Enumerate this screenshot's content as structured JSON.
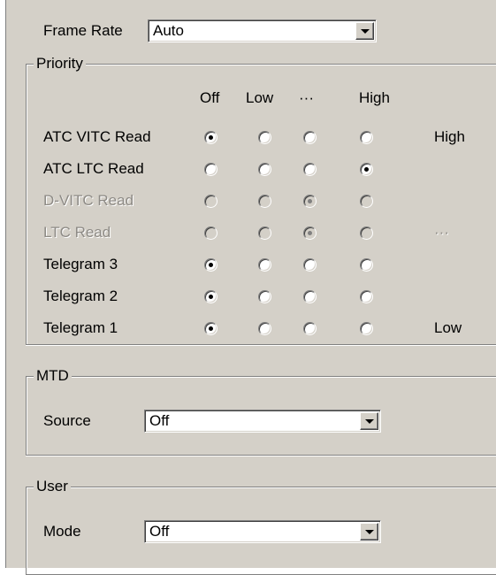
{
  "frame_rate": {
    "label": "Frame Rate",
    "value": "Auto"
  },
  "priority": {
    "title": "Priority",
    "columns": [
      "Off",
      "Low",
      "···",
      "High"
    ],
    "rows": [
      {
        "label": "ATC VITC Read",
        "selected": 0,
        "disabled": false,
        "side": "High"
      },
      {
        "label": "ATC LTC Read",
        "selected": 3,
        "disabled": false,
        "side": ""
      },
      {
        "label": "D-VITC Read",
        "selected": 2,
        "disabled": true,
        "side": ""
      },
      {
        "label": "LTC Read",
        "selected": 2,
        "disabled": true,
        "side": "···"
      },
      {
        "label": "Telegram 3",
        "selected": 0,
        "disabled": false,
        "side": ""
      },
      {
        "label": "Telegram 2",
        "selected": 0,
        "disabled": false,
        "side": ""
      },
      {
        "label": "Telegram 1",
        "selected": 0,
        "disabled": false,
        "side": "Low"
      }
    ]
  },
  "mtd": {
    "title": "MTD",
    "source_label": "Source",
    "source_value": "Off"
  },
  "user": {
    "title": "User",
    "mode_label": "Mode",
    "mode_value": "Off"
  }
}
